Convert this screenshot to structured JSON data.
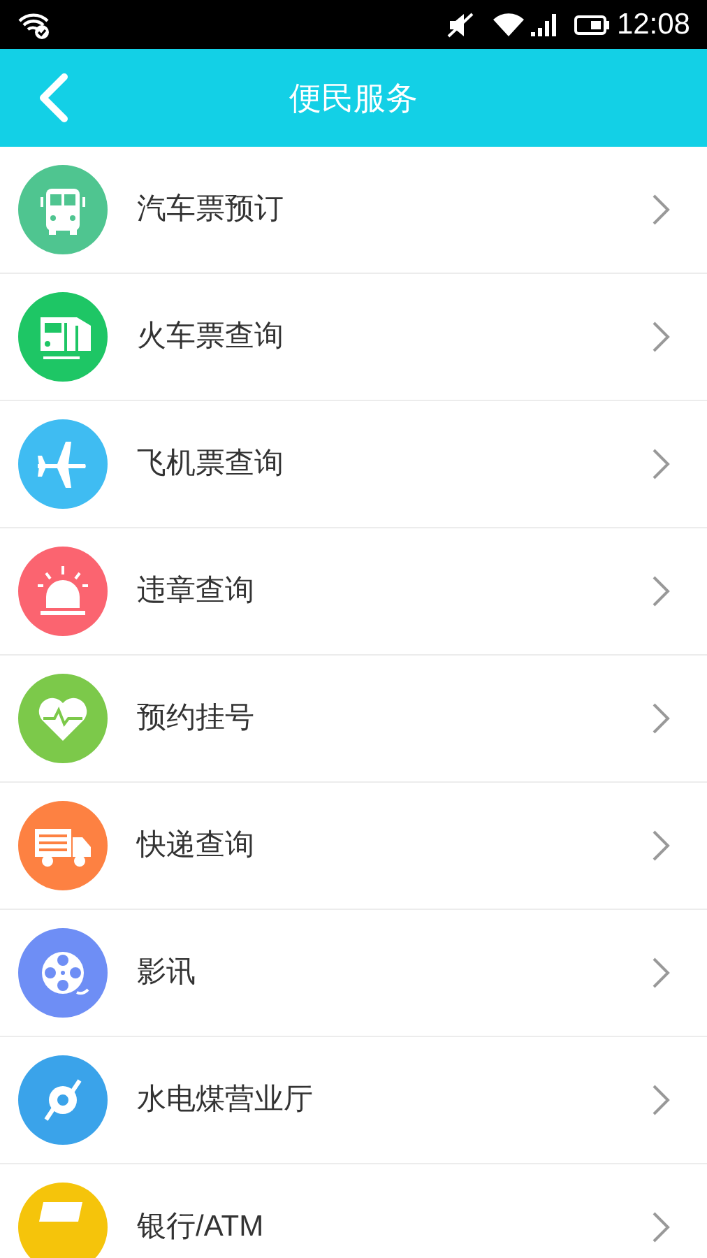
{
  "status_bar": {
    "time": "12:08"
  },
  "header": {
    "title": "便民服务"
  },
  "items": [
    {
      "label": "汽车票预订",
      "kind": "bus",
      "color": "#4fc590"
    },
    {
      "label": "火车票查询",
      "kind": "train",
      "color": "#1ec665"
    },
    {
      "label": "飞机票查询",
      "kind": "plane",
      "color": "#3fbcf2"
    },
    {
      "label": "违章查询",
      "kind": "siren",
      "color": "#fb6470"
    },
    {
      "label": "预约挂号",
      "kind": "heart",
      "color": "#7cc94a"
    },
    {
      "label": "快递查询",
      "kind": "truck",
      "color": "#fd8142"
    },
    {
      "label": "影讯",
      "kind": "film",
      "color": "#6e8ef5"
    },
    {
      "label": "水电煤营业厅",
      "kind": "compass",
      "color": "#3aa3ea"
    },
    {
      "label": "银行/ATM",
      "kind": "bank",
      "color": "#f5c40b"
    }
  ]
}
